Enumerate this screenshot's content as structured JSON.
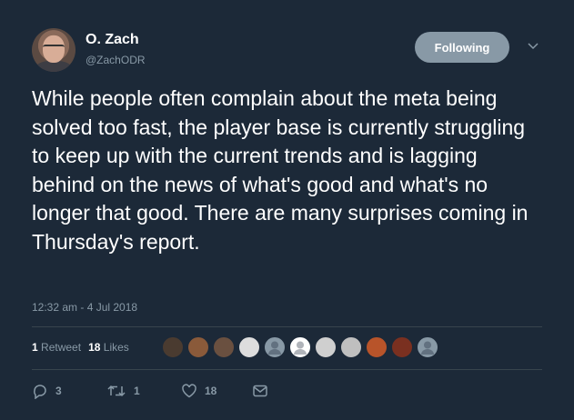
{
  "author": {
    "name": "O. Zach",
    "handle": "@ZachODR"
  },
  "follow_button": {
    "label": "Following"
  },
  "tweet": {
    "text": "While people often complain about the meta being solved too fast, the player base is currently struggling to keep up with the current trends and is lagging behind on the news of what's good and what's no longer that good. There are many surprises coming in Thursday's report.",
    "timestamp": "12:32 am - 4 Jul 2018"
  },
  "stats": {
    "retweets_count": "1",
    "retweets_label": "Retweet",
    "likes_count": "18",
    "likes_label": "Likes"
  },
  "likers": [
    {
      "icon": "avatar-icon",
      "color": "#4a3b30"
    },
    {
      "icon": "avatar-icon",
      "color": "#8a5a3a"
    },
    {
      "icon": "avatar-icon",
      "color": "#6a5040"
    },
    {
      "icon": "avatar-icon",
      "color": "#dddddd"
    },
    {
      "icon": "default-avatar-icon",
      "color": "#8899a6"
    },
    {
      "icon": "default-avatar-icon",
      "color": "#ffffff"
    },
    {
      "icon": "avatar-icon",
      "color": "#cfcfcf"
    },
    {
      "icon": "avatar-icon",
      "color": "#bfbfbf"
    },
    {
      "icon": "avatar-icon",
      "color": "#b8542a"
    },
    {
      "icon": "avatar-icon",
      "color": "#7a3020"
    },
    {
      "icon": "default-avatar-icon",
      "color": "#8899a6"
    }
  ],
  "actions": {
    "reply_count": "3",
    "retweet_count": "1",
    "like_count": "18"
  },
  "colors": {
    "background": "#1c2938",
    "secondary_text": "#8899a6",
    "divider": "#38444d"
  }
}
